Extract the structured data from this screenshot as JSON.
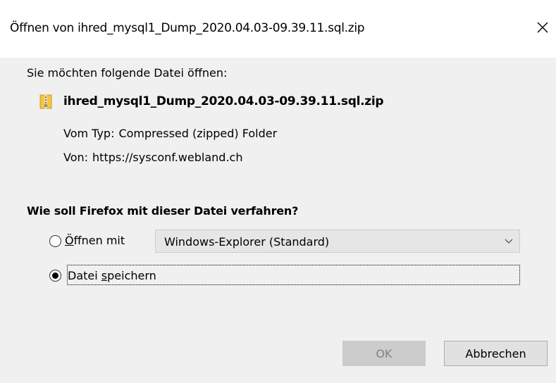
{
  "dialog": {
    "title": "Öffnen von ihred_mysql1_Dump_2020.04.03-09.39.11.sql.zip",
    "intro": "Sie möchten folgende Datei öffnen:",
    "file_icon": "zip-folder-icon",
    "file_name": "ihred_mysql1_Dump_2020.04.03-09.39.11.sql.zip",
    "type_key": "Vom Typ:",
    "type_value": "Compressed (zipped) Folder",
    "from_key": "Von:",
    "from_value": "https://sysconf.webland.ch",
    "question": "Wie soll Firefox mit dieser Datei verfahren?",
    "options": {
      "open_with": {
        "accel": "Ö",
        "rest": "ffnen mit",
        "checked": false
      },
      "save_file": {
        "pre": "Datei ",
        "accel": "s",
        "rest": "peichern",
        "checked": true
      }
    },
    "open_with_app": "Windows-Explorer (Standard)",
    "buttons": {
      "ok": "OK",
      "cancel": "Abbrechen"
    },
    "colors": {
      "icon_yellow": "#f5c542",
      "disabled_button": "#cccccc",
      "select_bg": "#e6e6e6"
    }
  }
}
